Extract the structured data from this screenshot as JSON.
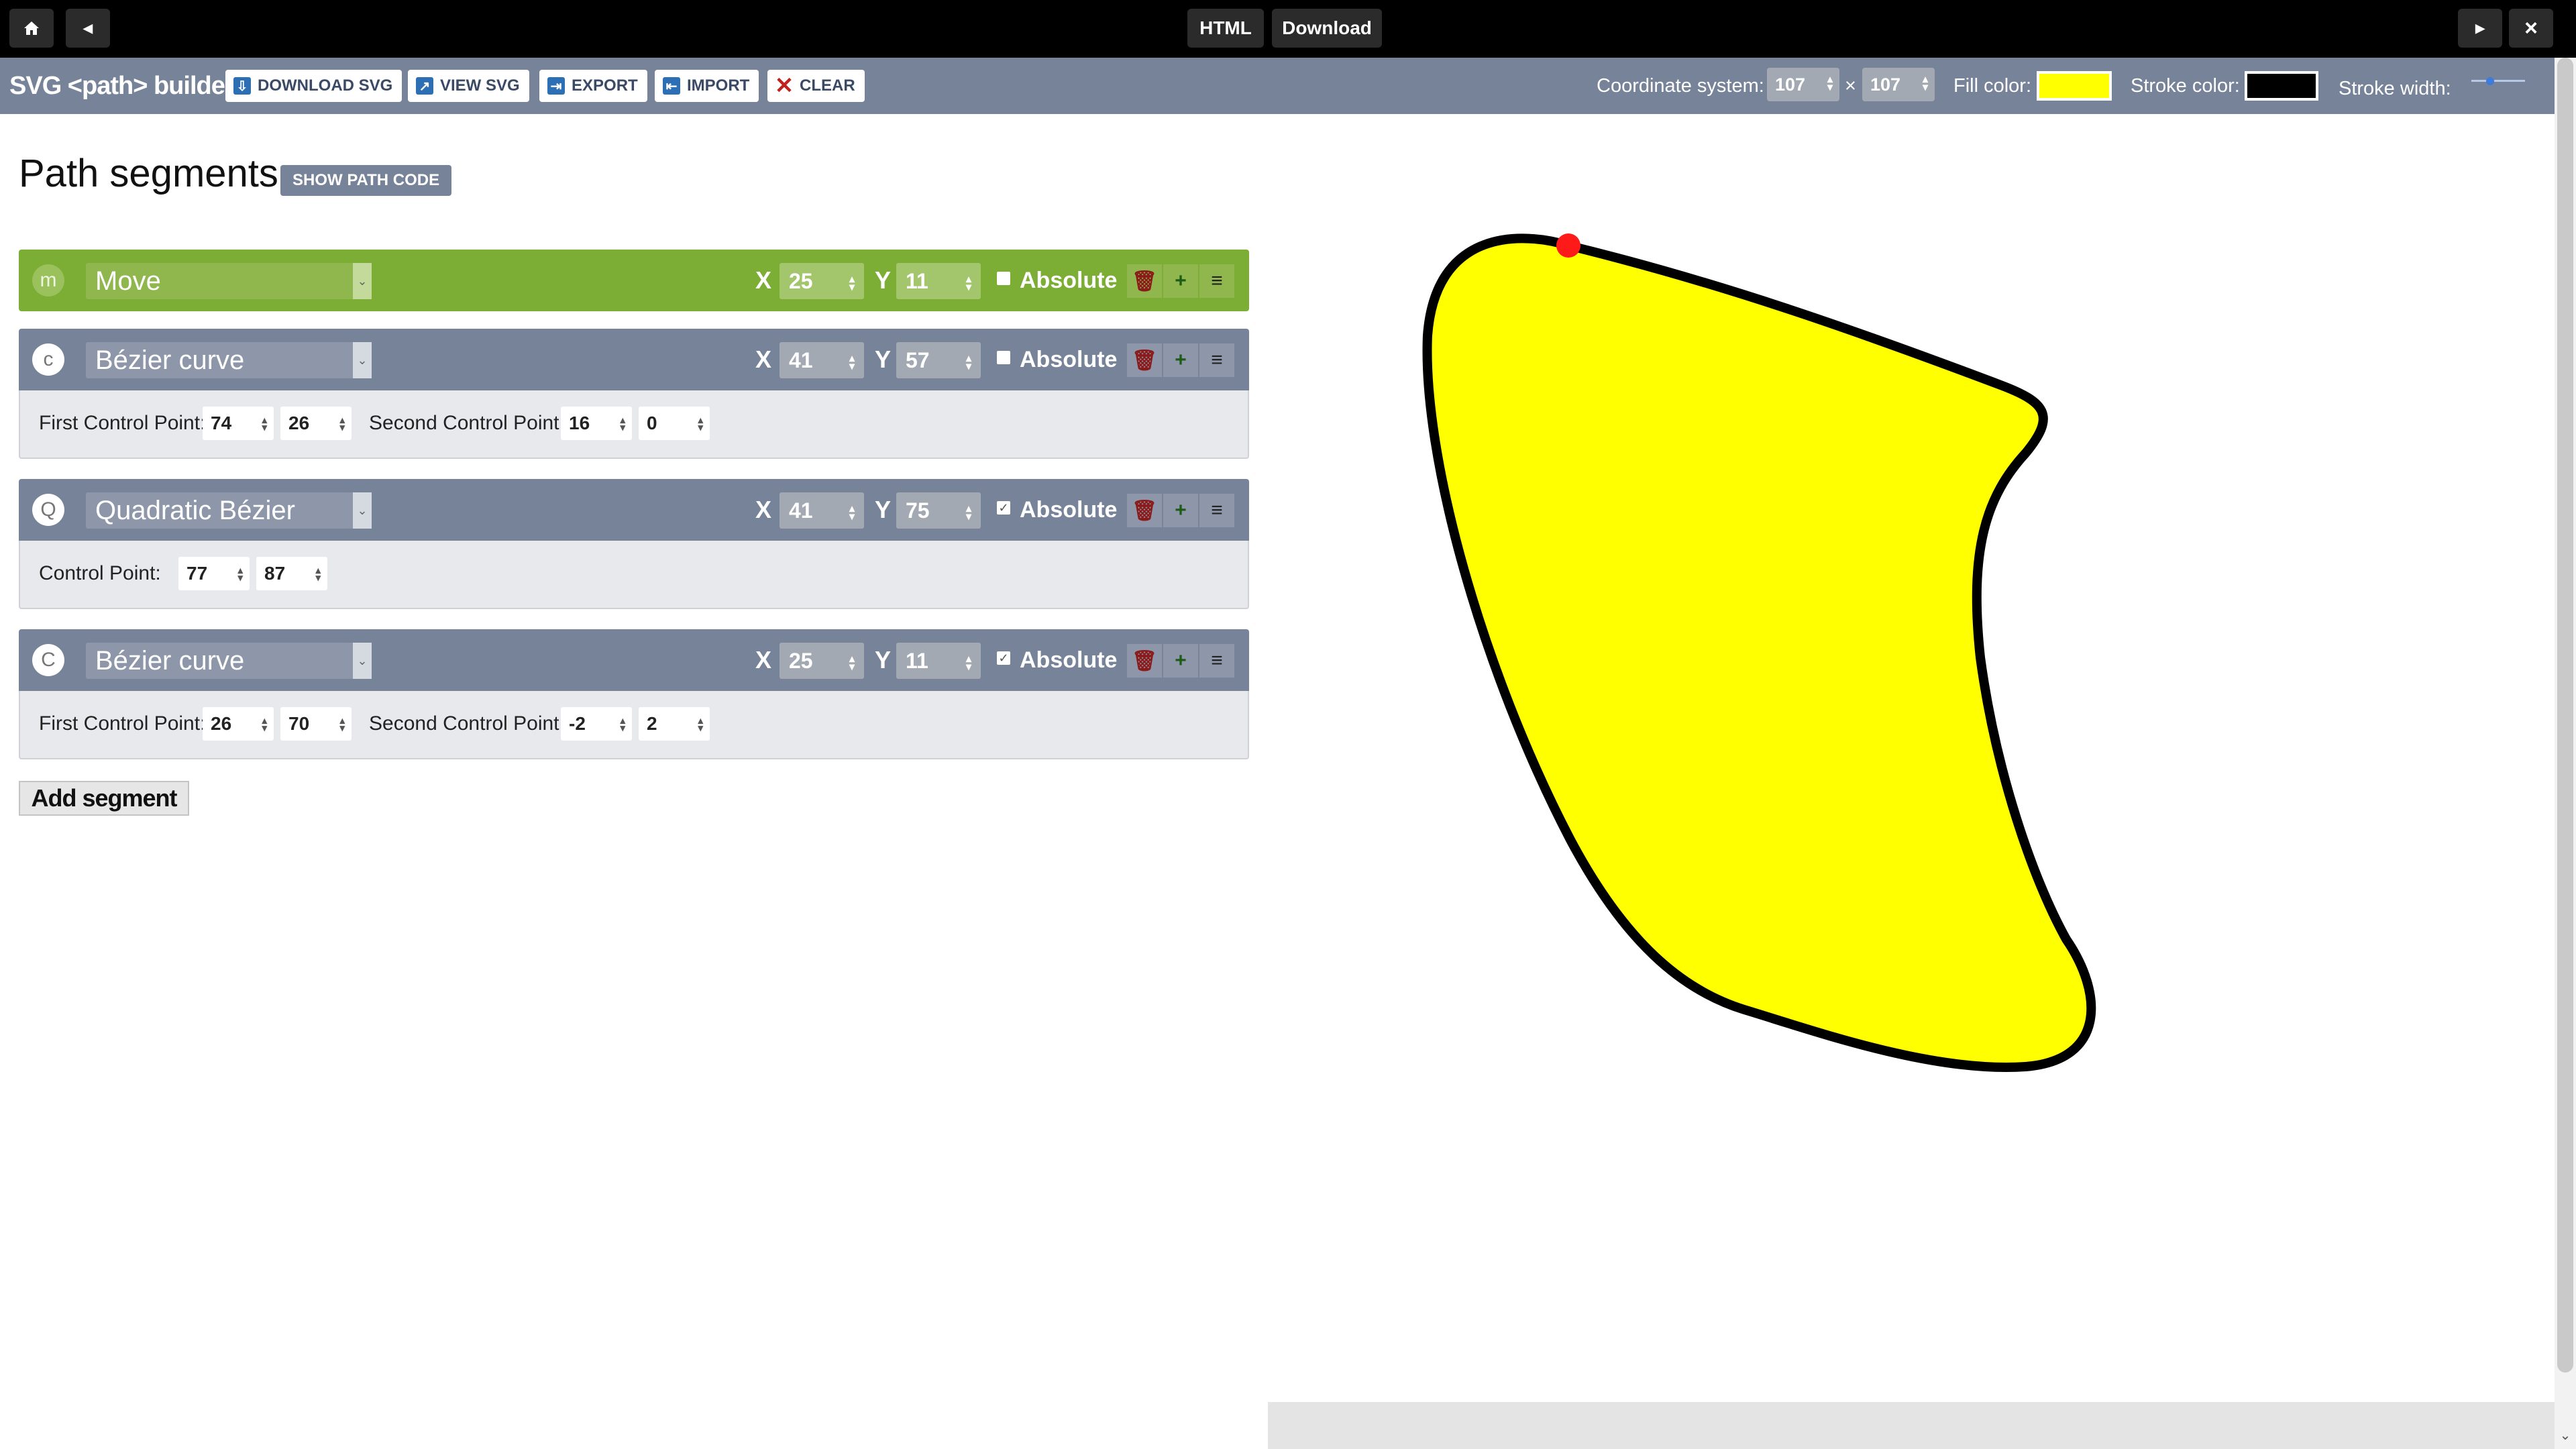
{
  "topbar": {
    "home_icon": "home-icon",
    "back_icon": "triangle-left-icon",
    "html_label": "HTML",
    "download_label": "Download",
    "forward_icon": "triangle-right-icon",
    "close_label": "×"
  },
  "toolbar": {
    "title": "SVG <path> builder",
    "download_svg": "DOWNLOAD SVG",
    "view_svg": "VIEW SVG",
    "export": "EXPORT",
    "import": "IMPORT",
    "clear": "CLEAR",
    "coord_label": "Coordinate system:",
    "coord_w": "107",
    "coord_times": "×",
    "coord_h": "107",
    "fill_label": "Fill color:",
    "fill_color": "#ffff00",
    "stroke_label": "Stroke color:",
    "stroke_color": "#000000",
    "stroke_width_label": "Stroke width:",
    "stroke_width_level": 0.35
  },
  "panel": {
    "title": "Path segments",
    "show_code": "SHOW PATH CODE",
    "add_segment": "Add segment",
    "x_label": "X",
    "y_label": "Y",
    "absolute_label": "Absolute",
    "first_cp_label": "First Control Point:",
    "second_cp_label": "Second Control Point:",
    "cp_label": "Control Point:"
  },
  "segments": [
    {
      "letter": "m",
      "type": "Move",
      "x": "25",
      "y": "11",
      "absolute": false
    },
    {
      "letter": "c",
      "type": "Bézier curve",
      "x": "41",
      "y": "57",
      "absolute": false,
      "cp1x": "74",
      "cp1y": "26",
      "cp2x": "16",
      "cp2y": "0"
    },
    {
      "letter": "Q",
      "type": "Quadratic Bézier",
      "x": "41",
      "y": "75",
      "absolute": true,
      "cpx": "77",
      "cpy": "87"
    },
    {
      "letter": "C",
      "type": "Bézier curve",
      "x": "25",
      "y": "11",
      "absolute": true,
      "cp1x": "26",
      "cp1y": "70",
      "cp2x": "-2",
      "cp2y": "2"
    }
  ],
  "colors": {
    "topbar": "#000000",
    "toolbar": "#778399",
    "move_segment": "#7cae35",
    "segment_head": "#778399",
    "point_marker": "#ff1a1a"
  }
}
